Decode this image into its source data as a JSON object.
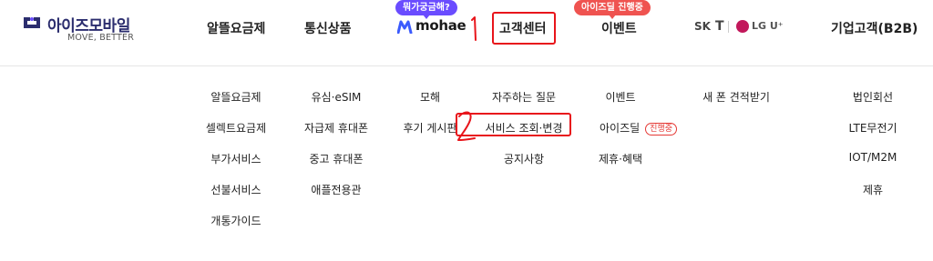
{
  "header": {
    "logo_text": "아이즈모바일",
    "logo_slogan": "MOVE, BETTER",
    "nav": {
      "plans": "알뜰요금제",
      "products": "통신상품",
      "mohae_bubble": "뭐가궁금해?",
      "mohae": "mohae",
      "support": "고객센터",
      "event_bubble": "아이즈딜 진행중",
      "event": "이벤트",
      "business": "기업고객(B2B)"
    },
    "carriers": {
      "sk": "SK",
      "kt": "T",
      "lgu": "LG U⁺"
    }
  },
  "menu": {
    "col1": [
      "알뜰요금제",
      "셀렉트요금제",
      "부가서비스",
      "선불서비스",
      "개통가이드"
    ],
    "col2": [
      "유심·eSIM",
      "자급제 휴대폰",
      "중고 휴대폰",
      "애플전용관"
    ],
    "col3": [
      "모해",
      "후기 게시판"
    ],
    "col4": [
      "자주하는 질문",
      "서비스 조회·변경",
      "공지사항"
    ],
    "col5": [
      "이벤트",
      "아이즈딜",
      "제휴·혜택"
    ],
    "col5_tag": "진행중",
    "col6": [
      "새 폰 견적받기"
    ],
    "col7": [
      "법인회선",
      "LTE무전기",
      "IOT/M2M",
      "제휴"
    ]
  },
  "annotations": {
    "one": "1",
    "two": "2"
  },
  "colors": {
    "brand": "#2b2d6e",
    "bubble_purple": "#6a4cff",
    "bubble_red": "#ef5350",
    "annotation": "#e8151b"
  }
}
